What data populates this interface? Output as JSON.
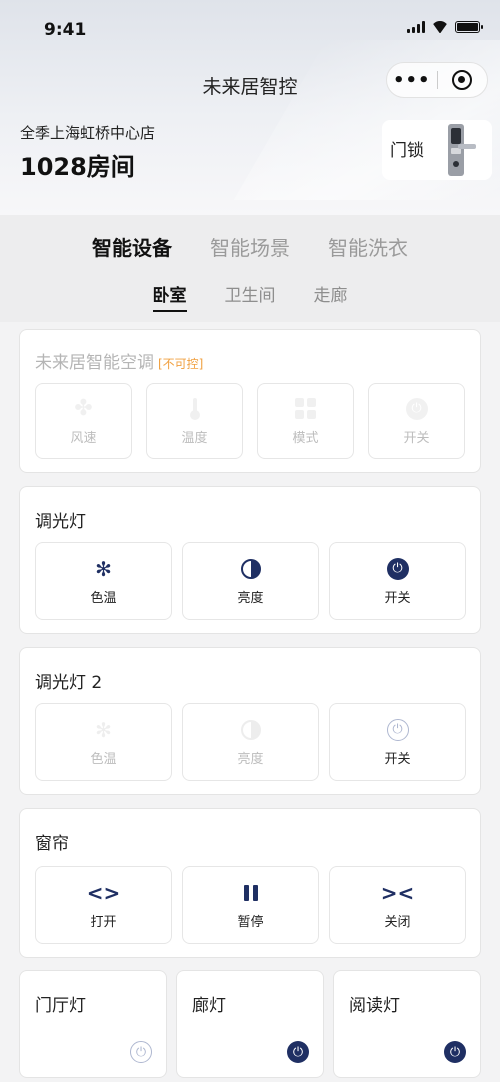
{
  "status": {
    "time": "9:41"
  },
  "header": {
    "app_title": "未来居智控",
    "capsule_more": "•••",
    "store_name": "全季上海虹桥中心店",
    "room_number": "1028房间",
    "door_lock_label": "门锁"
  },
  "main_tabs": [
    {
      "label": "智能设备",
      "active": true
    },
    {
      "label": "智能场景",
      "active": false
    },
    {
      "label": "智能洗衣",
      "active": false
    }
  ],
  "room_tabs": [
    {
      "label": "卧室",
      "active": true
    },
    {
      "label": "卫生间",
      "active": false
    },
    {
      "label": "走廊",
      "active": false
    }
  ],
  "aircon": {
    "title": "未来居智能空调",
    "status": "[不可控]",
    "buttons": [
      {
        "label": "风速",
        "icon": "fan-icon"
      },
      {
        "label": "温度",
        "icon": "thermometer-icon"
      },
      {
        "label": "模式",
        "icon": "grid-mode-icon"
      },
      {
        "label": "开关",
        "icon": "power-icon"
      }
    ]
  },
  "dimmer1": {
    "title": "调光灯",
    "buttons": [
      {
        "label": "色温",
        "icon": "color-temperature-icon"
      },
      {
        "label": "亮度",
        "icon": "brightness-icon"
      },
      {
        "label": "开关",
        "icon": "power-icon"
      }
    ]
  },
  "dimmer2": {
    "title": "调光灯 2",
    "buttons": [
      {
        "label": "色温",
        "icon": "color-temperature-icon"
      },
      {
        "label": "亮度",
        "icon": "brightness-icon"
      },
      {
        "label": "开关",
        "icon": "power-icon"
      }
    ]
  },
  "curtain": {
    "title": "窗帘",
    "buttons": [
      {
        "label": "打开",
        "icon": "open-arrows-icon"
      },
      {
        "label": "暂停",
        "icon": "pause-icon"
      },
      {
        "label": "关闭",
        "icon": "close-arrows-icon"
      }
    ]
  },
  "lights": [
    {
      "label": "门厅灯",
      "on": false
    },
    {
      "label": "廊灯",
      "on": true
    },
    {
      "label": "阅读灯",
      "on": true
    }
  ],
  "colors": {
    "accent": "#1f2f63",
    "warning": "#f0a040"
  }
}
